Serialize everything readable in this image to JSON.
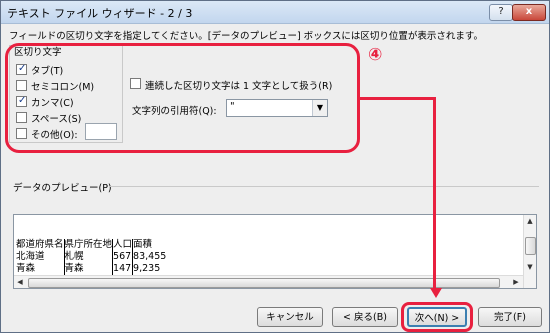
{
  "window": {
    "title": "テキスト ファイル ウィザード - 2 / 3",
    "help_label": "?",
    "close_label": "x"
  },
  "description": "フィールドの区切り文字を指定してください。[データのプレビュー] ボックスには区切り位置が表示されます。",
  "delimiters": {
    "group_label": "区切り文字",
    "options": [
      {
        "label": "タブ(T)",
        "checked": true
      },
      {
        "label": "セミコロン(M)",
        "checked": false
      },
      {
        "label": "カンマ(C)",
        "checked": true
      },
      {
        "label": "スペース(S)",
        "checked": false
      },
      {
        "label": "その他(O):",
        "checked": false
      }
    ],
    "other_value": "",
    "consecutive_label": "連続した区切り文字は 1 文字として扱う(R)",
    "consecutive_checked": false,
    "quote_label": "文字列の引用符(Q):",
    "quote_value": "\""
  },
  "annotation": {
    "step_marker": "④"
  },
  "preview": {
    "label": "データのプレビュー(P)",
    "columns": [
      "都道府県名",
      "県庁所在地",
      "人口",
      "面積"
    ],
    "rows": [
      [
        "北海道",
        "札幌",
        "567",
        "83,455"
      ],
      [
        "青森",
        "青森",
        "147",
        "9,235"
      ]
    ]
  },
  "buttons": {
    "cancel": "キャンセル",
    "back": "< 戻る(B)",
    "next": "次へ(N) >",
    "finish": "完了(F)"
  },
  "colors": {
    "annotation_red": "#e8203f",
    "checkbox_check": "#1a3e8c"
  }
}
